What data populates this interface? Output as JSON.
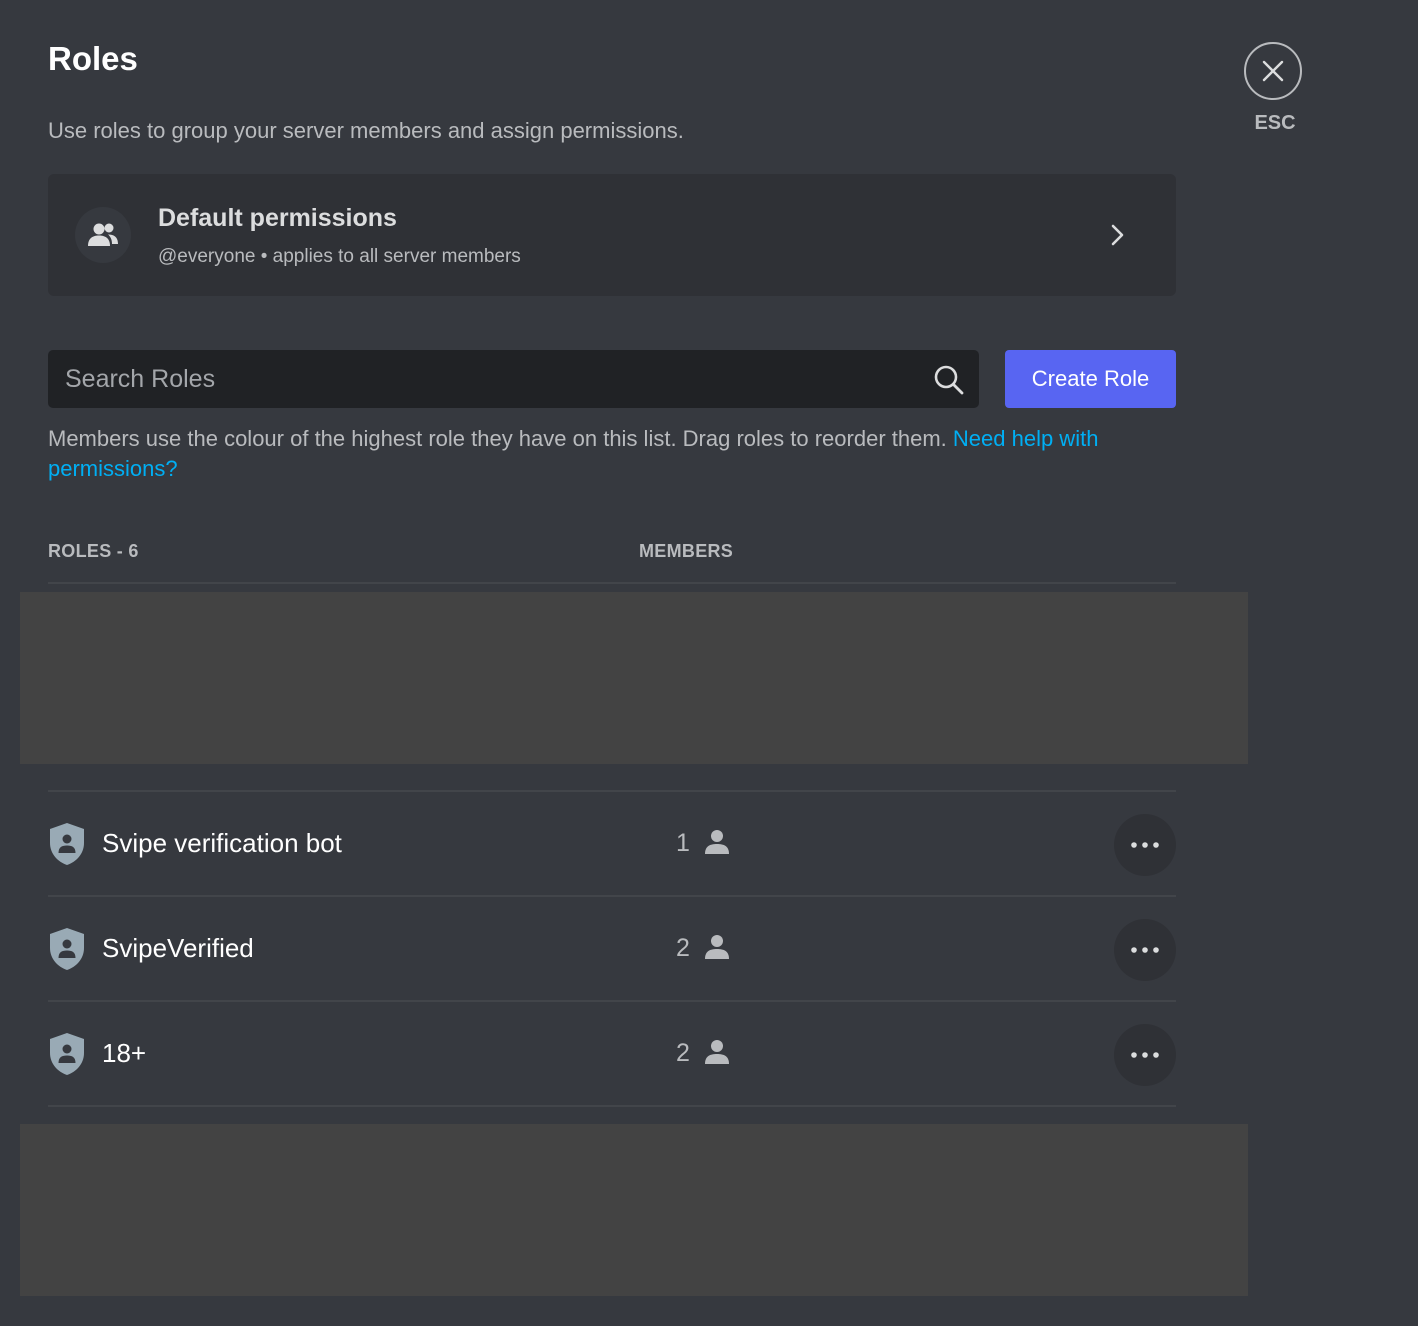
{
  "header": {
    "title": "Roles",
    "subtitle": "Use roles to group your server members and assign permissions."
  },
  "default_permissions": {
    "title": "Default permissions",
    "subtitle": "@everyone • applies to all server members",
    "icon": "people-icon"
  },
  "search": {
    "placeholder": "Search Roles",
    "value": ""
  },
  "create_role_label": "Create Role",
  "info": {
    "text": "Members use the colour of the highest role they have on this list. Drag roles to reorder them. ",
    "link": "Need help with permissions?"
  },
  "table": {
    "roles_header": "ROLES - 6",
    "members_header": "MEMBERS",
    "rows": [
      {
        "name": "Svipe verification bot",
        "members": "1",
        "color": "#99aab5"
      },
      {
        "name": "SvipeVerified",
        "members": "2",
        "color": "#99aab5"
      },
      {
        "name": "18+",
        "members": "2",
        "color": "#99aab5"
      }
    ]
  },
  "close": {
    "label": "ESC"
  },
  "colors": {
    "background": "#36393f",
    "card": "#2f3136",
    "accent": "#5865f2",
    "link": "#00aff4"
  }
}
